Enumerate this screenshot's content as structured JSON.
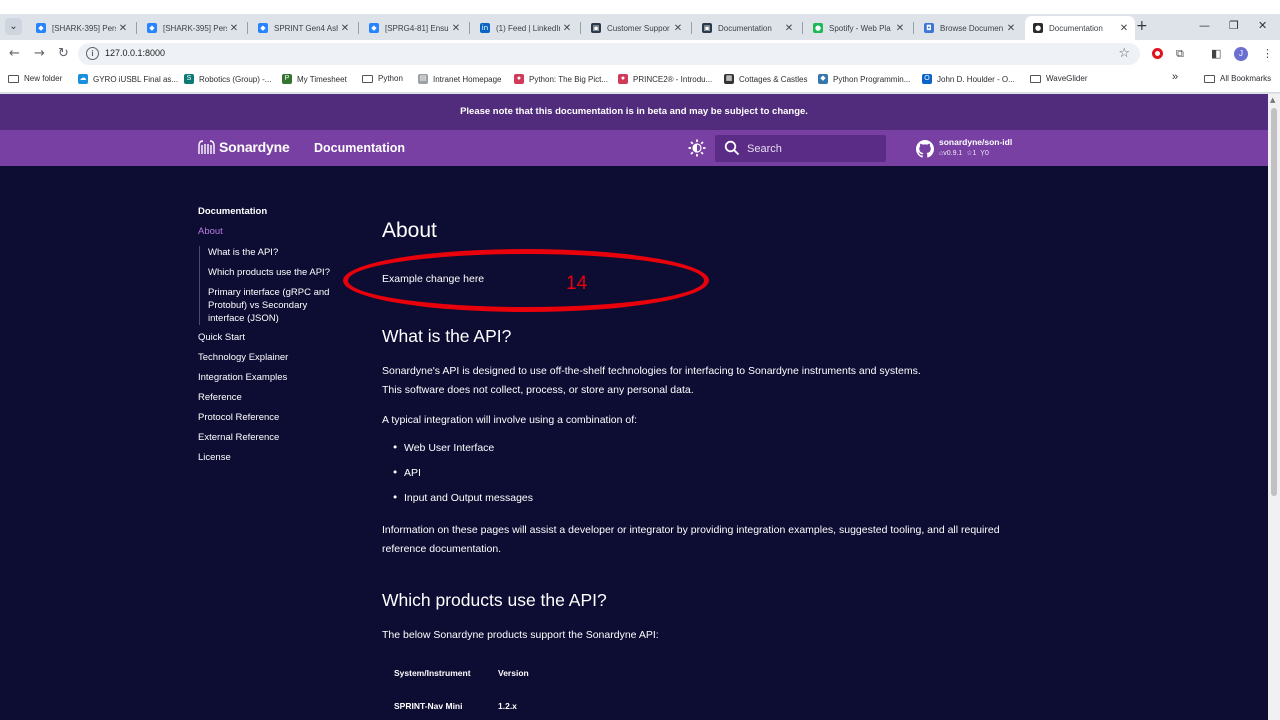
{
  "browser": {
    "tabs": [
      {
        "title": "[SHARK-395] Pers",
        "icon": "jira-icon",
        "color": "#2684ff",
        "glyph": "◆"
      },
      {
        "title": "[SHARK-395] Pers",
        "icon": "jira-icon",
        "color": "#2684ff",
        "glyph": "◆"
      },
      {
        "title": "SPRINT Gen4 Ash",
        "icon": "jira-icon",
        "color": "#2684ff",
        "glyph": "◆"
      },
      {
        "title": "[SPRG4-81] Ensur",
        "icon": "jira-icon",
        "color": "#2684ff",
        "glyph": "◆"
      },
      {
        "title": "(1) Feed | LinkedIn",
        "icon": "linkedin-icon",
        "color": "#0a66c2",
        "glyph": "in"
      },
      {
        "title": "Customer Suppor",
        "icon": "doc-icon",
        "color": "#2b3a4a",
        "glyph": "▣"
      },
      {
        "title": "Documentation",
        "icon": "doc-icon",
        "color": "#2b3a4a",
        "glyph": "▣"
      },
      {
        "title": "Spotify - Web Pla",
        "icon": "spotify-icon",
        "color": "#1db954",
        "glyph": "●"
      },
      {
        "title": "Browse Documen",
        "icon": "shield-icon",
        "color": "#3c74d8",
        "glyph": "◘"
      },
      {
        "title": "Documentation",
        "icon": "doc-icon",
        "color": "#2a2a2a",
        "glyph": "●",
        "active": true
      }
    ],
    "new_tab": "+",
    "url": "127.0.0.1:8000",
    "bookmarks": [
      {
        "label": "New folder",
        "icon": "folder-icon"
      },
      {
        "label": "GYRO iUSBL Final as...",
        "icon": "salesforce-icon",
        "color": "#1a8fdd",
        "glyph": "☁"
      },
      {
        "label": "Robotics (Group) -...",
        "icon": "sharepoint-icon",
        "color": "#0b7a75",
        "glyph": "S"
      },
      {
        "label": "My Timesheet",
        "icon": "project-icon",
        "color": "#31752f",
        "glyph": "P"
      },
      {
        "label": "Python",
        "icon": "folder-icon"
      },
      {
        "label": "Intranet Homepage",
        "icon": "intranet-icon",
        "color": "#9aa0a6",
        "glyph": "▤"
      },
      {
        "label": "Python: The Big Pict...",
        "icon": "site-icon",
        "color": "#d03a58",
        "glyph": "●"
      },
      {
        "label": "PRINCE2® - Introdu...",
        "icon": "site-icon",
        "color": "#d03a58",
        "glyph": "●"
      },
      {
        "label": "Cottages & Castles",
        "icon": "cottages-icon",
        "color": "#333333",
        "glyph": "▦"
      },
      {
        "label": "Python Programmin...",
        "icon": "python-icon",
        "color": "#3776ab",
        "glyph": "◆"
      },
      {
        "label": "John D. Houlder - O...",
        "icon": "outlook-icon",
        "color": "#0a64c8",
        "glyph": "O"
      },
      {
        "label": "WaveGlider",
        "icon": "folder-icon"
      }
    ],
    "more_bookmarks": "»",
    "all_bookmarks": "All Bookmarks",
    "profile_initial": "J"
  },
  "page": {
    "banner": "Please note that this documentation is in beta and may be subject to change.",
    "logo_text": "Sonardyne",
    "site_title": "Documentation",
    "search_placeholder": "Search",
    "repo": {
      "name": "sonardyne/son-idl",
      "version": "v0.9.1",
      "stars": "1",
      "forks": "0"
    },
    "colors": {
      "banner": "#522c7c",
      "header": "#7740a2",
      "background": "#0d0c33",
      "active_link": "#b57ddb"
    },
    "sidebar": {
      "heading": "Documentation",
      "current": "About",
      "sub_items": [
        "What is the API?",
        "Which products use the API?",
        "Primary interface (gRPC and Protobuf) vs Secondary interface (JSON)"
      ],
      "items": [
        "Quick Start",
        "Technology Explainer",
        "Integration Examples",
        "Reference",
        "Protocol Reference",
        "External Reference",
        "License"
      ]
    },
    "content": {
      "title": "About",
      "example": "Example change here",
      "h_api": "What is the API?",
      "p1_line1": "Sonardyne's API is designed to use off-the-shelf technologies for interfacing to Sonardyne instruments and systems.",
      "p1_line2": "This software does not collect, process, or store any personal data.",
      "p2": "A typical integration will involve using a combination of:",
      "list": [
        "Web User Interface",
        "API",
        "Input and Output messages"
      ],
      "p3_line1": "Information on these pages will assist a developer or integrator by providing integration examples, suggested tooling, and all required",
      "p3_line2": "reference documentation.",
      "h_products": "Which products use the API?",
      "p4": "The below Sonardyne products support the Sonardyne API:",
      "table": {
        "headers": [
          "System/Instrument",
          "Version"
        ],
        "rows": [
          [
            "SPRINT-Nav Mini",
            "1.2.x"
          ]
        ]
      }
    },
    "annotation": {
      "number": "14",
      "color": "#e8000b"
    }
  }
}
